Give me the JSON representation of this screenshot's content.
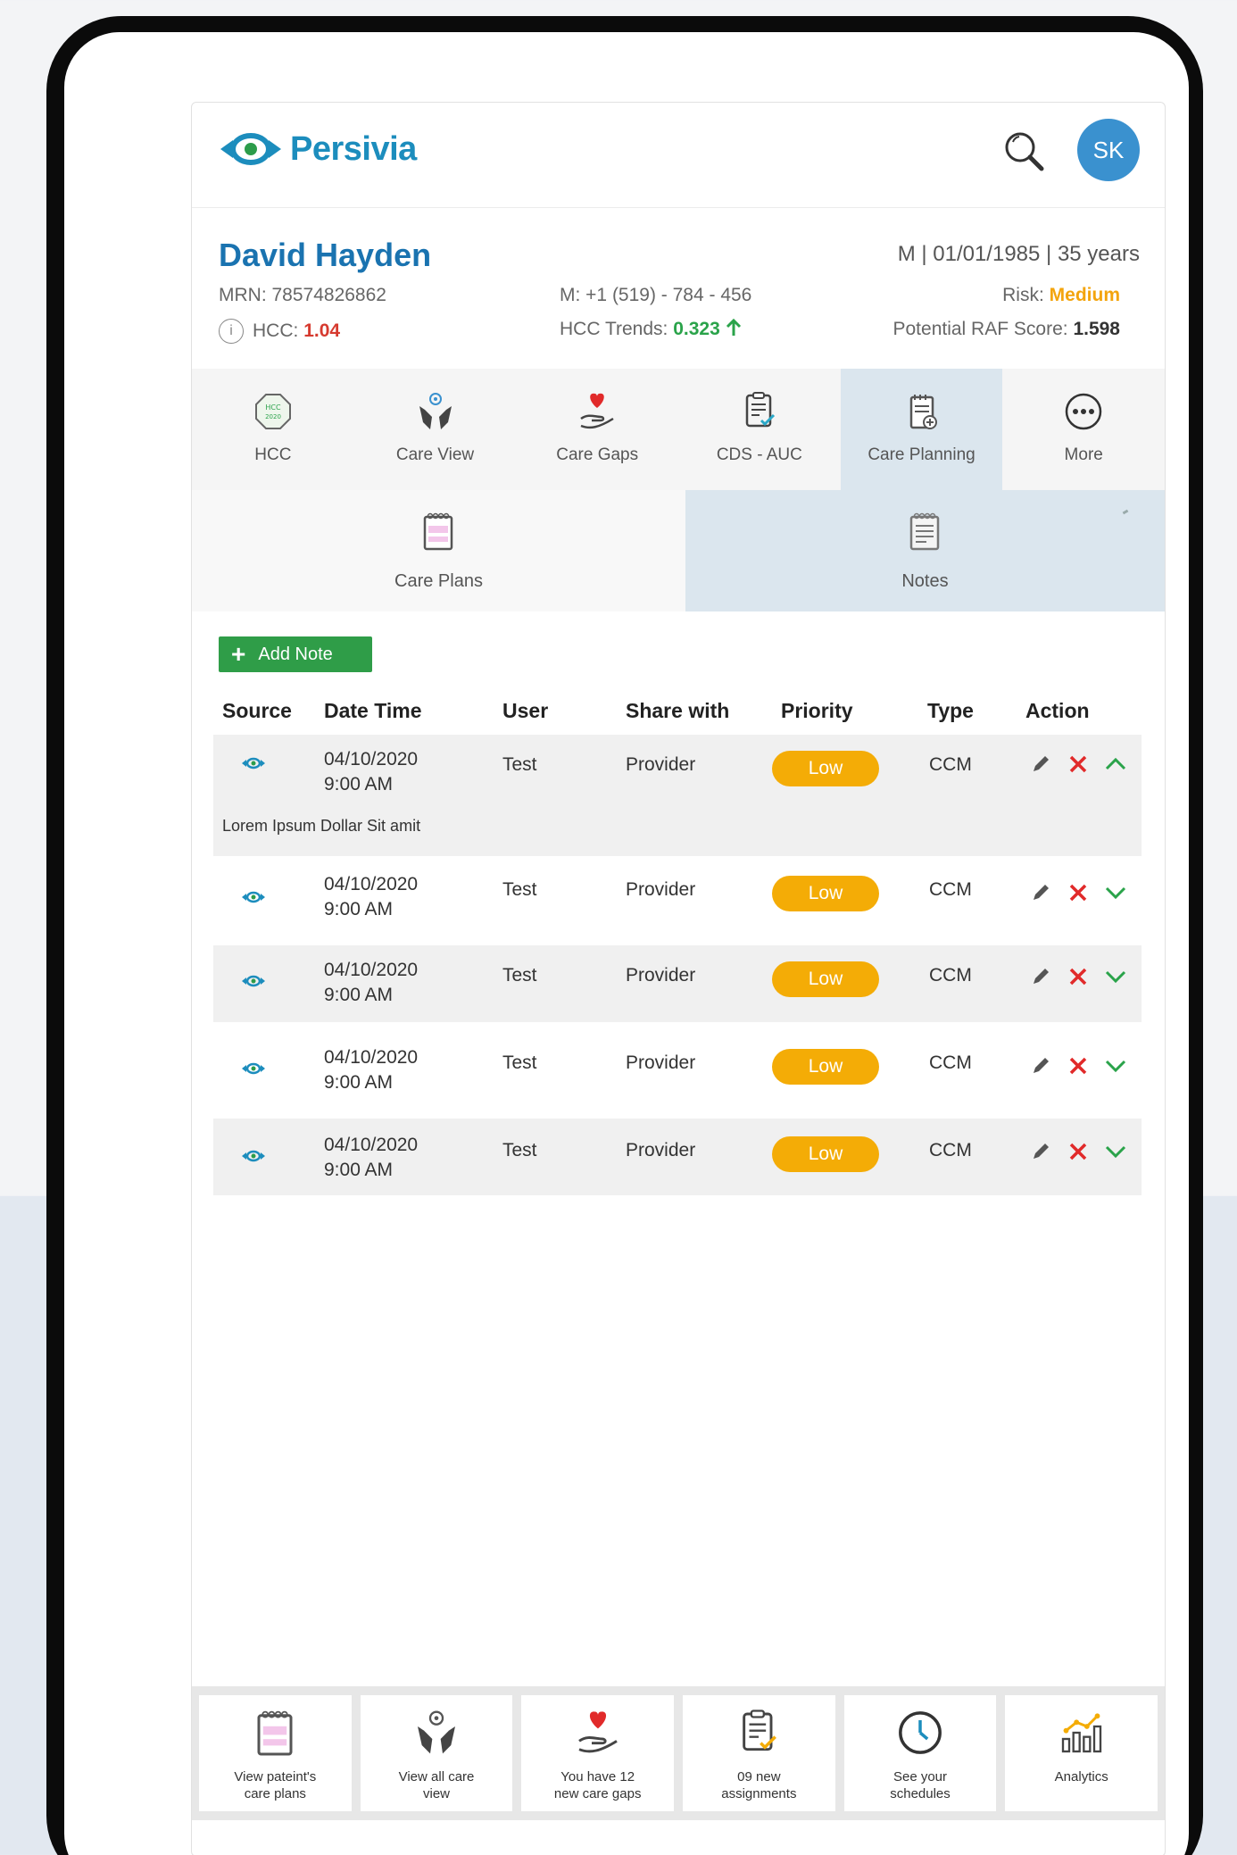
{
  "app": {
    "brand": "Persivia",
    "avatar_initials": "SK",
    "accent_color": "#1a73b0"
  },
  "patient": {
    "name": "David Hayden",
    "demographics": "M | 01/01/1985 | 35 years",
    "mrn": "MRN: 78574826862",
    "phone": "M: +1 (519) - 784 - 456",
    "risk_label": "Risk:",
    "risk_value": "Medium",
    "hcc_label": "HCC:",
    "hcc_value": "1.04",
    "hcc_trends_label": "HCC Trends:",
    "hcc_trends_value": "0.323",
    "raf_label": "Potential RAF Score:",
    "raf_value": "1.598"
  },
  "nav_tabs": [
    {
      "label": "HCC",
      "icon": "hcc-badge-icon"
    },
    {
      "label": "Care View",
      "icon": "care-view-hands-icon"
    },
    {
      "label": "Care Gaps",
      "icon": "heart-hand-icon"
    },
    {
      "label": "CDS - AUC",
      "icon": "clipboard-check-icon"
    },
    {
      "label": "Care Planning",
      "icon": "care-planning-icon",
      "active": true
    },
    {
      "label": "More",
      "icon": "more-dots-icon"
    }
  ],
  "sub_tabs": [
    {
      "label": "Care Plans",
      "icon": "notepad-icon"
    },
    {
      "label": "Notes",
      "icon": "notes-icon",
      "active": true
    }
  ],
  "add_note_label": "Add Note",
  "table": {
    "headers": [
      "Source",
      "Date Time",
      "User",
      "Share with",
      "Priority",
      "Type",
      "Action"
    ],
    "rows": [
      {
        "date": "04/10/2020",
        "time": "9:00 AM",
        "user": "Test",
        "share": "Provider",
        "priority": "Low",
        "type": "CCM",
        "expanded": true,
        "note": "Lorem Ipsum Dollar Sit amit"
      },
      {
        "date": "04/10/2020",
        "time": "9:00 AM",
        "user": "Test",
        "share": "Provider",
        "priority": "Low",
        "type": "CCM"
      },
      {
        "date": "04/10/2020",
        "time": "9:00 AM",
        "user": "Test",
        "share": "Provider",
        "priority": "Low",
        "type": "CCM"
      },
      {
        "date": "04/10/2020",
        "time": "9:00 AM",
        "user": "Test",
        "share": "Provider",
        "priority": "Low",
        "type": "CCM"
      },
      {
        "date": "04/10/2020",
        "time": "9:00 AM",
        "user": "Test",
        "share": "Provider",
        "priority": "Low",
        "type": "CCM"
      }
    ]
  },
  "bottom_cards": [
    {
      "label": "View pateint's care plans",
      "icon": "notepad-icon"
    },
    {
      "label": "View all care view",
      "icon": "care-view-hands-icon"
    },
    {
      "label": "You have 12 new care gaps",
      "icon": "heart-hand-icon"
    },
    {
      "label": "09 new assignments",
      "icon": "clipboard-check-icon"
    },
    {
      "label": "See your schedules",
      "icon": "clock-icon"
    },
    {
      "label": "Analytics",
      "icon": "analytics-icon"
    }
  ]
}
